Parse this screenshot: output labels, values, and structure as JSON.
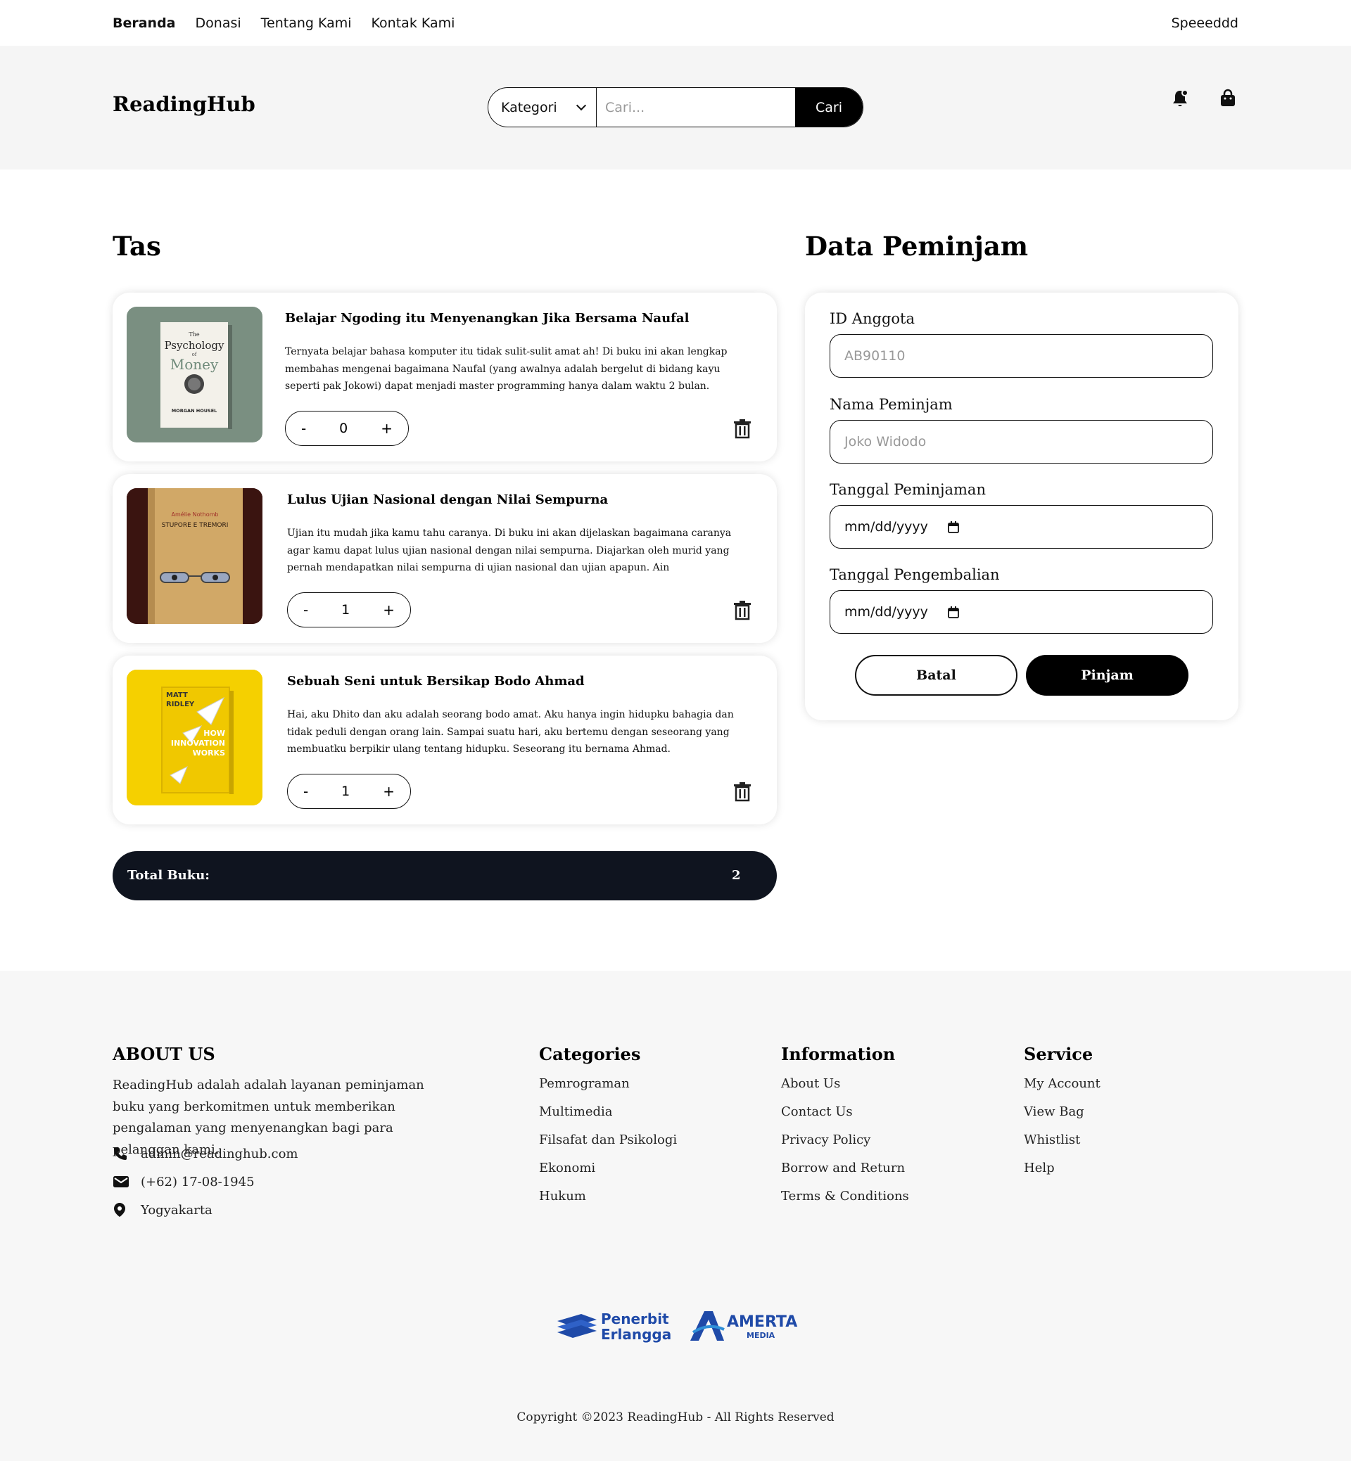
{
  "topnav": {
    "links": [
      "Beranda",
      "Donasi",
      "Tentang Kami",
      "Kontak Kami"
    ],
    "active": "Beranda",
    "user": "Speeeddd"
  },
  "header": {
    "logo": "ReadingHub",
    "category_label": "Kategori",
    "search_placeholder": "Cari...",
    "search_button": "Cari",
    "icons": [
      "bell-icon",
      "shopping-bag-icon"
    ]
  },
  "cart": {
    "title": "Tas",
    "items": [
      {
        "title": "Belajar Ngoding itu Menyenangkan Jika Bersama Naufal",
        "description": "Ternyata belajar bahasa komputer itu tidak sulit-sulit amat ah! Di buku ini akan lengkap membahas mengenai bagaimana Naufal (yang awalnya adalah bergelut di bidang kayu seperti pak Jokowi) dapat menjadi master programming hanya dalam waktu 2 bulan.",
        "quantity": "0",
        "cover": {
          "line1": "The",
          "line2": "Psychology",
          "line3": "of",
          "line4": "Money",
          "author": "MORGAN HOUSEL",
          "bg": "#7a8f81"
        }
      },
      {
        "title": "Lulus Ujian Nasional dengan Nilai Sempurna",
        "description": "Ujian itu mudah jika kamu tahu caranya. Di buku ini akan dijelaskan bagaimana caranya agar kamu dapat lulus ujian nasional dengan nilai sempurna. Diajarkan oleh murid yang pernah mendapatkan nilai sempurna di ujian nasional dan ujian apapun. Ain",
        "quantity": "1",
        "cover": {
          "author": "Amélie Nothomb",
          "title": "STUPORE E TREMORI",
          "bg": "#3a1410"
        }
      },
      {
        "title": "Sebuah Seni untuk Bersikap Bodo Ahmad",
        "description": "Hai, aku Dhito dan aku adalah seorang bodo amat. Aku hanya ingin hidupku bahagia dan tidak peduli dengan orang lain. Sampai suatu hari, aku bertemu dengan seseorang yang membuatku berpikir ulang tentang hidupku. Seseorang itu bernama Ahmad.",
        "quantity": "1",
        "cover": {
          "author1": "MATT",
          "author2": "RIDLEY",
          "t1": "HOW",
          "t2": "INNOVATION",
          "t3": "WORKS",
          "bg": "#f5d000"
        }
      }
    ],
    "minus": "-",
    "plus": "+",
    "total_label": "Total Buku:",
    "total_value": "2"
  },
  "form": {
    "title": "Data Peminjam",
    "fields": [
      {
        "label": "ID Anggota",
        "placeholder": "AB90110"
      },
      {
        "label": "Nama Peminjam",
        "placeholder": "Joko Widodo"
      },
      {
        "label": "Tanggal Peminjaman",
        "value": "mm/dd/yyyy"
      },
      {
        "label": "Tanggal Pengembalian",
        "value": "mm/dd/yyyy"
      }
    ],
    "cancel": "Batal",
    "submit": "Pinjam"
  },
  "footer": {
    "about": {
      "title": "ABOUT US",
      "text": "ReadingHub adalah adalah layanan peminjaman buku yang berkomitmen untuk memberikan pengalaman yang menyenangkan bagi para pelanggan kami.",
      "email": "admin@readinghub.com",
      "phone": "(+62) 17-08-1945",
      "location": "Yogyakarta"
    },
    "categories": {
      "title": "Categories",
      "items": [
        "Pemrograman",
        "Multimedia",
        "Filsafat dan Psikologi",
        "Ekonomi",
        "Hukum"
      ]
    },
    "information": {
      "title": "Information",
      "items": [
        "About Us",
        "Contact Us",
        "Privacy Policy",
        "Borrow and Return",
        "Terms & Conditions"
      ]
    },
    "service": {
      "title": "Service",
      "items": [
        "My Account",
        "View Bag",
        "Whistlist",
        "Help"
      ]
    },
    "partners": {
      "p1_line1": "Penerbit",
      "p1_line2": "Erlangga",
      "p2_line1": "AMERTA",
      "p2_line2": "MEDIA"
    },
    "copyright": "Copyright ©2023 ReadingHub - All Rights Reserved"
  }
}
